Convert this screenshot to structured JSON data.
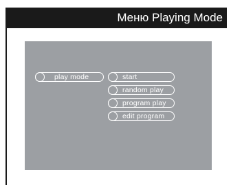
{
  "header": {
    "title": "Меню Playing Mode"
  },
  "menu": {
    "category_label": "play mode",
    "options": [
      {
        "label": "start"
      },
      {
        "label": "random play"
      },
      {
        "label": "program play"
      },
      {
        "label": "edit program"
      }
    ]
  },
  "colors": {
    "header_bg": "#1a1a1a",
    "screen_bg": "#9c9fa3",
    "outline": "#ffffff"
  }
}
